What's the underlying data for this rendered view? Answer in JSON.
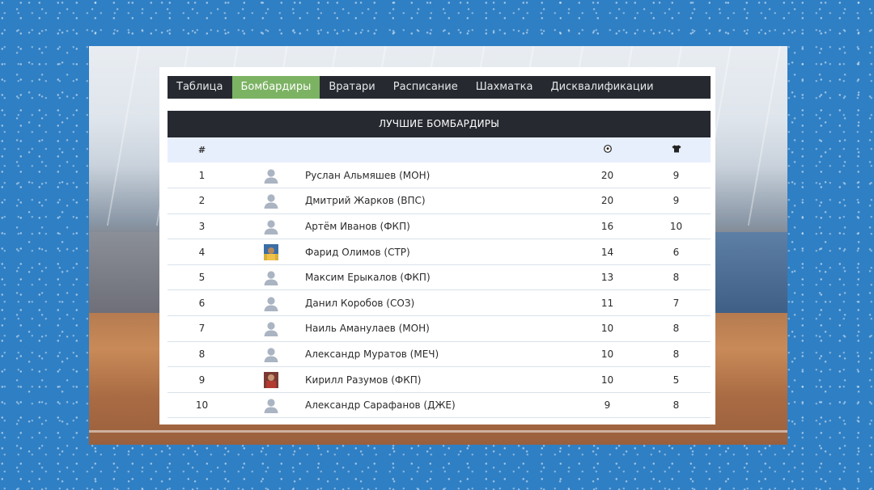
{
  "tabs": [
    {
      "label": "Таблица",
      "active": false
    },
    {
      "label": "Бомбардиры",
      "active": true
    },
    {
      "label": "Вратари",
      "active": false
    },
    {
      "label": "Расписание",
      "active": false
    },
    {
      "label": "Шахматка",
      "active": false
    },
    {
      "label": "Дисквалификации",
      "active": false
    }
  ],
  "scorers": {
    "title": "ЛУЧШИЕ БОМБАРДИРЫ",
    "columns": {
      "rank": "#",
      "goals_icon": "soccer-ball-icon",
      "games_icon": "shirt-icon"
    },
    "rows": [
      {
        "rank": "1",
        "name": "Руслан Альмяшев (МОН)",
        "goals": "20",
        "games": "9",
        "avatar": "default"
      },
      {
        "rank": "2",
        "name": "Дмитрий Жарков (ВПС)",
        "goals": "20",
        "games": "9",
        "avatar": "default"
      },
      {
        "rank": "3",
        "name": "Артём Иванов (ФКП)",
        "goals": "16",
        "games": "10",
        "avatar": "default"
      },
      {
        "rank": "4",
        "name": "Фарид Олимов (СТР)",
        "goals": "14",
        "games": "6",
        "avatar": "photo"
      },
      {
        "rank": "5",
        "name": "Максим Ерыкалов (ФКП)",
        "goals": "13",
        "games": "8",
        "avatar": "default"
      },
      {
        "rank": "6",
        "name": "Данил Коробов (СОЗ)",
        "goals": "11",
        "games": "7",
        "avatar": "default"
      },
      {
        "rank": "7",
        "name": "Наиль Аманулаев (МОН)",
        "goals": "10",
        "games": "8",
        "avatar": "default"
      },
      {
        "rank": "8",
        "name": "Александр Муратов (МЕЧ)",
        "goals": "10",
        "games": "8",
        "avatar": "default"
      },
      {
        "rank": "9",
        "name": "Кирилл Разумов (ФКП)",
        "goals": "10",
        "games": "5",
        "avatar": "photo"
      },
      {
        "rank": "10",
        "name": "Александр Сарафанов (ДЖЕ)",
        "goals": "9",
        "games": "8",
        "avatar": "default"
      }
    ]
  },
  "colors": {
    "background": "#2f7fc4",
    "tab_bar": "#262a30",
    "tab_active": "#7cb363",
    "header_row": "#e8effc",
    "avatar_default": "#aab4c2"
  }
}
